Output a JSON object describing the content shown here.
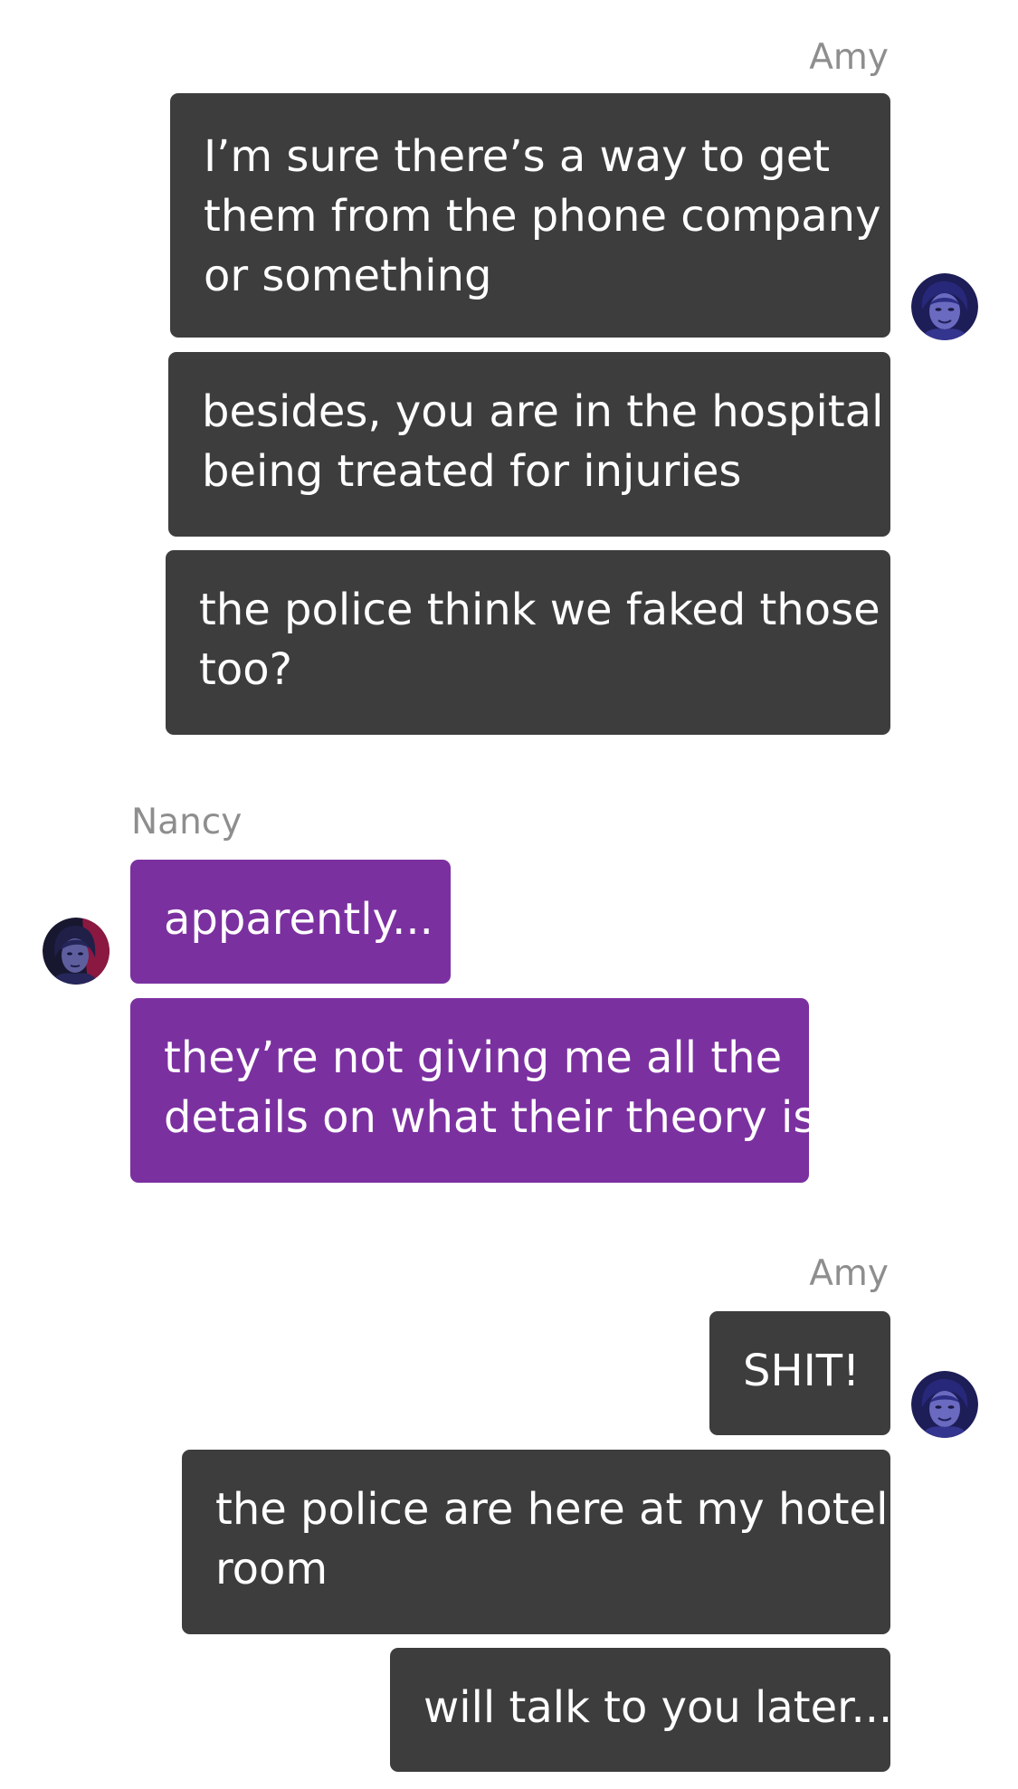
{
  "conversation": [
    {
      "sender": "Amy",
      "side": "outgoing",
      "avatar_icon": "amy-avatar-icon",
      "messages": [
        [
          "I’m sure there’s a way to get",
          "them from the phone company",
          "or something"
        ],
        [
          "besides, you are in the hospital",
          "being treated for injuries"
        ],
        [
          "the police think we faked those",
          "too?"
        ]
      ]
    },
    {
      "sender": "Nancy",
      "side": "incoming",
      "avatar_icon": "nancy-avatar-icon",
      "messages": [
        [
          "apparently..."
        ],
        [
          "they’re not giving me all the",
          "details on what their theory is"
        ]
      ]
    },
    {
      "sender": "Amy",
      "side": "outgoing",
      "avatar_icon": "amy-avatar-icon",
      "messages": [
        [
          "SHIT!"
        ],
        [
          "the police are here at my hotel",
          "room"
        ],
        [
          "will talk to you later..."
        ]
      ]
    }
  ],
  "colors": {
    "outgoing_bubble": "#3d3d3d",
    "incoming_bubble": "#7b30a0",
    "sender_label": "#8e8e8e",
    "bubble_text": "#ffffff"
  }
}
